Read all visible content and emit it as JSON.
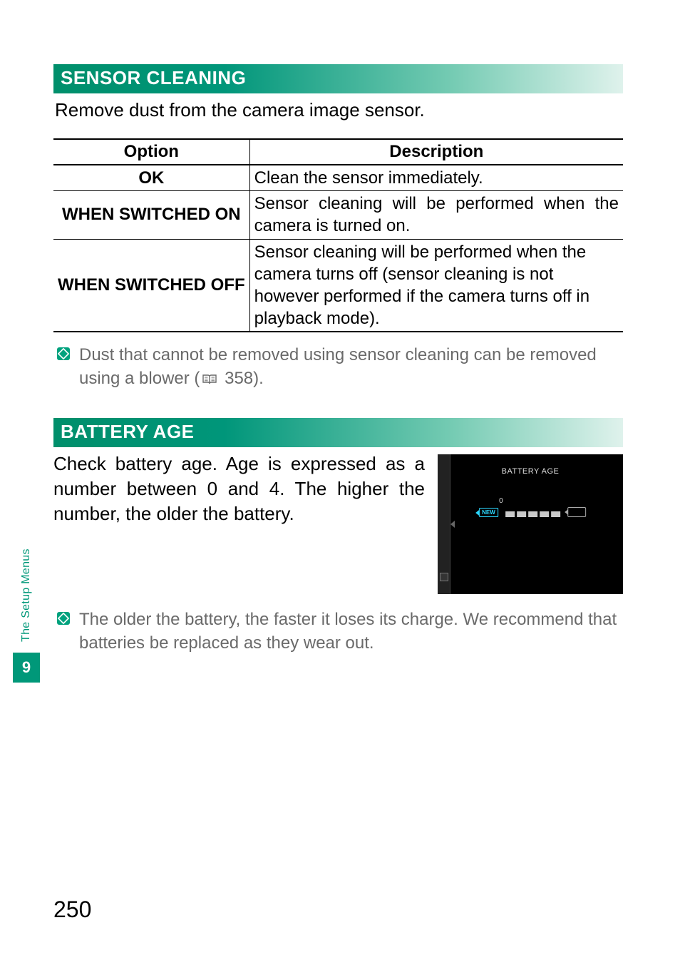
{
  "sections": {
    "sensor_cleaning": {
      "title": "SENSOR CLEANING",
      "intro": "Remove dust from the camera image sensor.",
      "table": {
        "header_option": "Option",
        "header_description": "Description",
        "rows": [
          {
            "option": "OK",
            "description": "Clean the sensor immediately."
          },
          {
            "option": "WHEN SWITCHED ON",
            "description": "Sensor cleaning will be performed when the camera is turned on."
          },
          {
            "option": "WHEN SWITCHED OFF",
            "description": "Sensor cleaning will be performed when the camera turns off (sensor cleaning is not however performed if the camera turns off in playback mode)."
          }
        ]
      },
      "note_before": "Dust that cannot be removed using sensor cleaning can be removed using a blower (",
      "note_pageref": "358",
      "note_after": ")."
    },
    "battery_age": {
      "title": "BATTERY AGE",
      "intro": "Check battery age. Age is expressed as a number between 0 and 4. The higher the number, the older the battery.",
      "screenshot": {
        "title": "BATTERY AGE",
        "new_label": "NEW",
        "zero_label": "0"
      },
      "note": "The older the battery, the faster it loses its charge. We recommend that batteries be replaced as they wear out."
    }
  },
  "side_tab": {
    "label": "The Setup Menus",
    "chapter": "9"
  },
  "page_number": "250"
}
